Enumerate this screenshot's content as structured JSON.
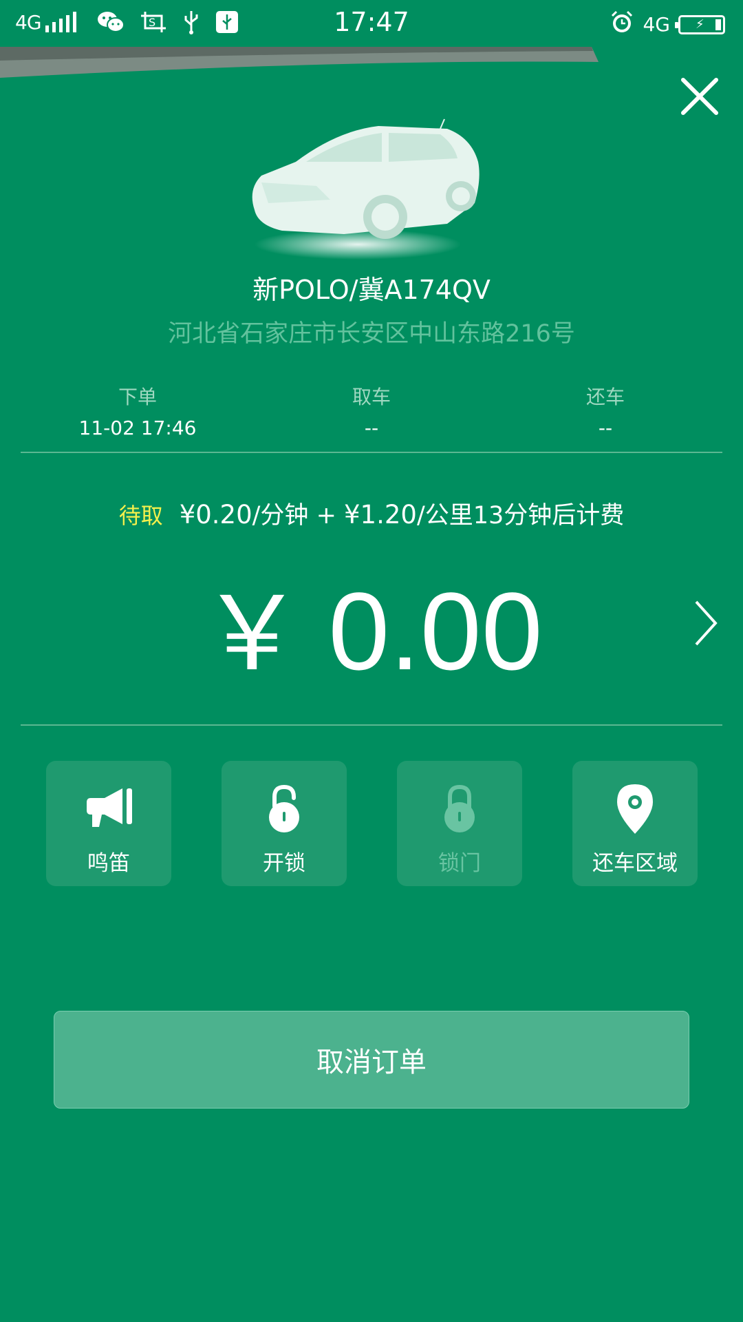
{
  "status_bar": {
    "network_left": "4G",
    "time": "17:47",
    "network_right": "4G"
  },
  "car": {
    "title": "新POLO/冀A174QV",
    "address": "河北省石家庄市长安区中山东路216号"
  },
  "timeline": [
    {
      "label": "下单",
      "value": "11-02 17:46"
    },
    {
      "label": "取车",
      "value": "--"
    },
    {
      "label": "还车",
      "value": "--"
    }
  ],
  "pricing": {
    "status": "待取",
    "per_minute_price": "¥0.20",
    "per_minute_unit": "/分钟",
    "plus": " + ",
    "per_km_price": "¥1.20",
    "per_km_unit": "/公里",
    "note": "13分钟后计费"
  },
  "fee": {
    "currency": "￥",
    "amount": "0.00"
  },
  "actions": [
    {
      "label": "鸣笛",
      "icon": "horn-icon",
      "enabled": true
    },
    {
      "label": "开锁",
      "icon": "unlock-icon",
      "enabled": true
    },
    {
      "label": "锁门",
      "icon": "lock-icon",
      "enabled": false
    },
    {
      "label": "还车区域",
      "icon": "location-pin-icon",
      "enabled": true
    }
  ],
  "cancel_label": "取消订单",
  "colors": {
    "background": "#008e5f",
    "action_tile": "#1f9a6f",
    "status_highlight": "#f5f04c",
    "button": "#4cb28e"
  }
}
